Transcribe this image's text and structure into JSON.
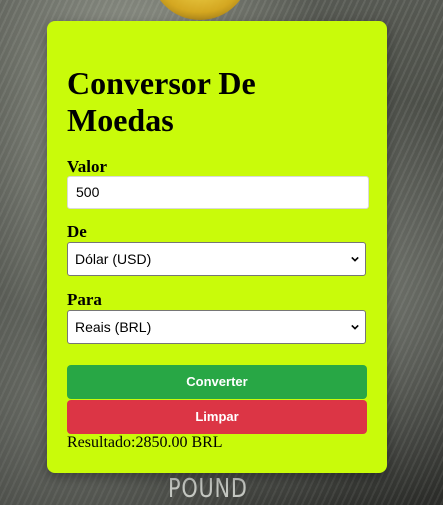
{
  "converter": {
    "title": "Conversor De Moedas",
    "amount_label": "Valor",
    "amount_value": "500",
    "from_label": "De",
    "from_selected": "Dólar (USD)",
    "to_label": "Para",
    "to_selected": "Reais (BRL)",
    "convert_button": "Converter",
    "clear_button": "Limpar",
    "result_prefix": "Resultado:",
    "result_value": "2850.00 BRL"
  },
  "background": {
    "bill_text": "POUND"
  },
  "colors": {
    "card": "#c9fb0a",
    "convert": "#28a745",
    "clear": "#dc3545"
  }
}
